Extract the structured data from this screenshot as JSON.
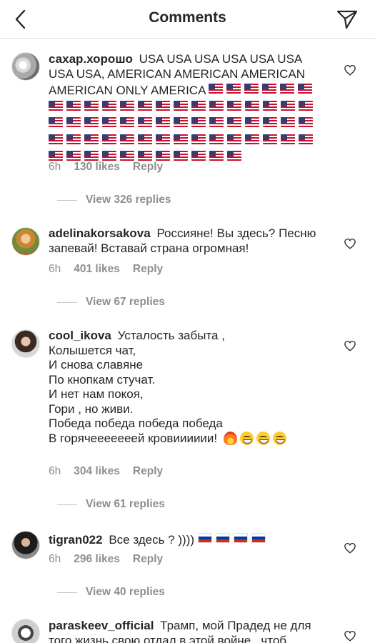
{
  "header": {
    "title": "Comments"
  },
  "icons": {
    "back": "chevron-left-icon",
    "share": "paper-plane-icon",
    "like": "heart-outline-icon"
  },
  "colors": {
    "text": "#262626",
    "secondary": "#8e8e8e",
    "divider": "#dbdbdb"
  },
  "comments": [
    {
      "username": "сахар.хорошо",
      "text": "USA USA USA USA USA USA USA USA, AMERICAN AMERICAN AMERICAN AMERICAN ONLY AMERICA",
      "flags": "us",
      "flag_count": 62,
      "time": "6h",
      "likes": "130 likes",
      "reply": "Reply",
      "view_replies": "View 326 replies"
    },
    {
      "username": "adelinakorsakova",
      "text": "Россияне! Вы здесь? Песню запевай! Вставай страна огромная!",
      "time": "6h",
      "likes": "401 likes",
      "reply": "Reply",
      "view_replies": "View 67 replies"
    },
    {
      "username": "cool_ikova",
      "text": "Усталость забыта ,\nКолышется чат,\nИ снова славяне\nПо кнопкам стучат.\nИ нет нам покоя,\nГори , но живи.\nПобеда победа победа победа\nВ горячееееееей кровииииии!",
      "emojis": [
        "fire",
        "grin",
        "grin",
        "grin"
      ],
      "time": "6h",
      "likes": "304 likes",
      "reply": "Reply",
      "view_replies": "View 61 replies"
    },
    {
      "username": "tigran022",
      "text": "Все здесь ? ))))",
      "flags": "ru",
      "flag_count": 4,
      "time": "6h",
      "likes": "296 likes",
      "reply": "Reply",
      "view_replies": "View 40 replies"
    },
    {
      "username": "paraskeev_official",
      "text": "Трамп, мой Прадед не для того жизнь свою отдал в этой войне , чтоб"
    }
  ]
}
